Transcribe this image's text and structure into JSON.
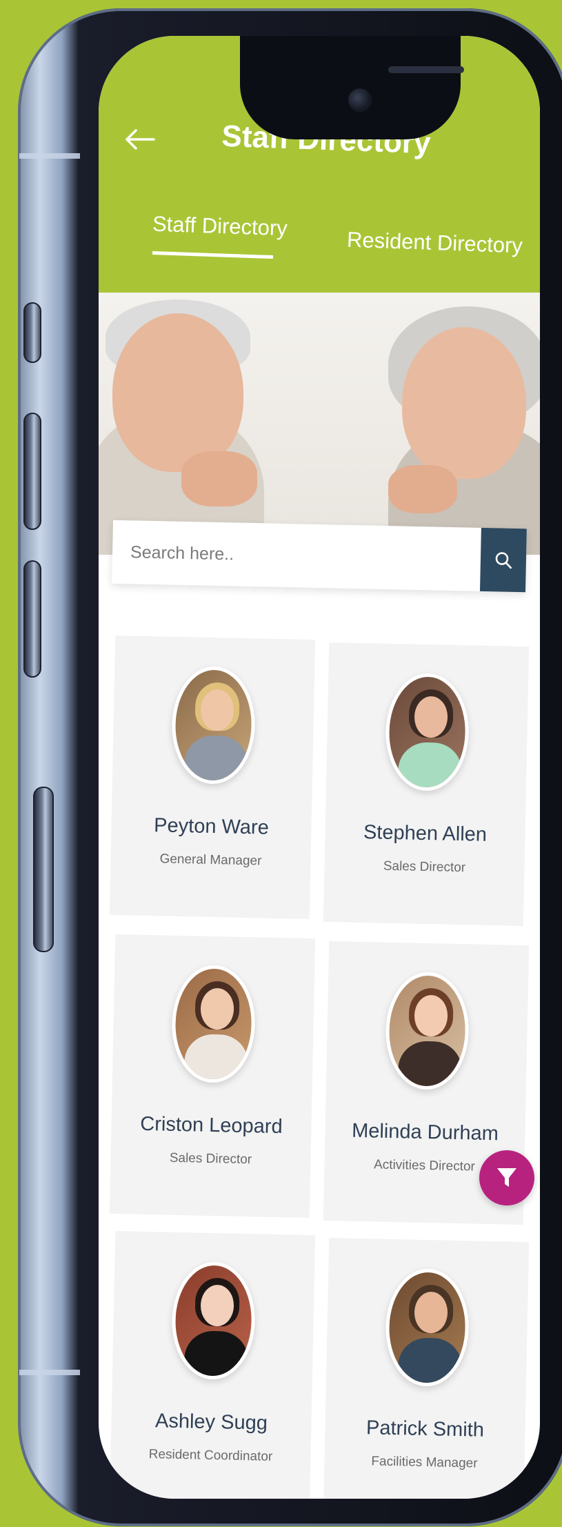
{
  "header": {
    "back_icon": "arrow-left-icon",
    "title": "Staff Directory"
  },
  "tabs": [
    {
      "label": "Staff Directory",
      "active": true
    },
    {
      "label": "Resident Directory",
      "active": false
    }
  ],
  "search": {
    "placeholder": "Search here..",
    "button_icon": "search-icon"
  },
  "staff": [
    {
      "name": "Peyton Ware",
      "role": "General Manager"
    },
    {
      "name": "Stephen Allen",
      "role": "Sales Director"
    },
    {
      "name": "Criston Leopard",
      "role": "Sales Director"
    },
    {
      "name": "Melinda Durham",
      "role": "Activities Director"
    },
    {
      "name": "Ashley Sugg",
      "role": "Resident Coordinator"
    },
    {
      "name": "Patrick Smith",
      "role": "Facilities Manager"
    }
  ],
  "fab": {
    "icon": "filter-icon"
  },
  "colors": {
    "brand": "#a9c536",
    "search_button": "#2e4a60",
    "fab": "#b7227f",
    "name_text": "#2f3f55"
  }
}
